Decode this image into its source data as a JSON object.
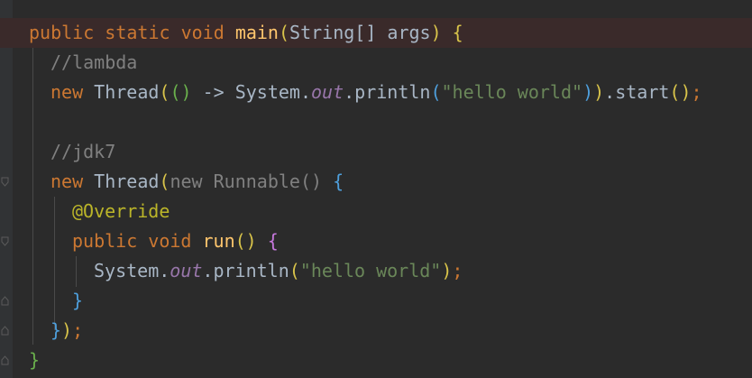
{
  "editor": {
    "lines": [
      {
        "tokens": [
          {
            "text": "public",
            "cls": "kw"
          },
          {
            "text": " ",
            "cls": "id"
          },
          {
            "text": "static",
            "cls": "kw"
          },
          {
            "text": " ",
            "cls": "id"
          },
          {
            "text": "void",
            "cls": "kw"
          },
          {
            "text": " ",
            "cls": "id"
          },
          {
            "text": "main",
            "cls": "fn"
          },
          {
            "text": "(",
            "cls": "b1"
          },
          {
            "text": "String[] args",
            "cls": "id"
          },
          {
            "text": ")",
            "cls": "b1"
          },
          {
            "text": " ",
            "cls": "id"
          },
          {
            "text": "{",
            "cls": "b1"
          }
        ]
      },
      {
        "tokens": [
          {
            "text": "//lambda",
            "cls": "cm"
          }
        ]
      },
      {
        "tokens": [
          {
            "text": "new",
            "cls": "kw"
          },
          {
            "text": " Thread",
            "cls": "id"
          },
          {
            "text": "(",
            "cls": "b1"
          },
          {
            "text": "()",
            "cls": "b4"
          },
          {
            "text": " -> System.",
            "cls": "id"
          },
          {
            "text": "out",
            "cls": "fld"
          },
          {
            "text": ".println",
            "cls": "id"
          },
          {
            "text": "(",
            "cls": "b3"
          },
          {
            "text": "\"hello world\"",
            "cls": "st"
          },
          {
            "text": ")",
            "cls": "b3"
          },
          {
            "text": ")",
            "cls": "b1"
          },
          {
            "text": ".start",
            "cls": "id"
          },
          {
            "text": "()",
            "cls": "b1"
          },
          {
            "text": ";",
            "cls": "kw"
          }
        ]
      },
      {
        "tokens": []
      },
      {
        "tokens": [
          {
            "text": "//jdk7",
            "cls": "cm"
          }
        ]
      },
      {
        "tokens": [
          {
            "text": "new",
            "cls": "kw"
          },
          {
            "text": " Thread",
            "cls": "id"
          },
          {
            "text": "(",
            "cls": "b1"
          },
          {
            "text": "new Runnable",
            "cls": "dim"
          },
          {
            "text": "()",
            "cls": "dim"
          },
          {
            "text": " ",
            "cls": "id"
          },
          {
            "text": "{",
            "cls": "b3"
          }
        ]
      },
      {
        "tokens": [
          {
            "text": "@Override",
            "cls": "an"
          }
        ]
      },
      {
        "tokens": [
          {
            "text": "public",
            "cls": "kw"
          },
          {
            "text": " ",
            "cls": "id"
          },
          {
            "text": "void",
            "cls": "kw"
          },
          {
            "text": " ",
            "cls": "id"
          },
          {
            "text": "run",
            "cls": "fn"
          },
          {
            "text": "()",
            "cls": "b1"
          },
          {
            "text": " ",
            "cls": "id"
          },
          {
            "text": "{",
            "cls": "b2"
          }
        ]
      },
      {
        "tokens": [
          {
            "text": "System.",
            "cls": "id"
          },
          {
            "text": "out",
            "cls": "fld"
          },
          {
            "text": ".println",
            "cls": "id"
          },
          {
            "text": "(",
            "cls": "b1"
          },
          {
            "text": "\"hello world\"",
            "cls": "st"
          },
          {
            "text": ")",
            "cls": "b1"
          },
          {
            "text": ";",
            "cls": "kw"
          }
        ]
      },
      {
        "tokens": [
          {
            "text": "}",
            "cls": "b3"
          }
        ]
      },
      {
        "tokens": [
          {
            "text": "}",
            "cls": "b3"
          },
          {
            "text": ")",
            "cls": "b1"
          },
          {
            "text": ";",
            "cls": "kw"
          }
        ]
      },
      {
        "tokens": [
          {
            "text": "}",
            "cls": "b4"
          }
        ]
      }
    ],
    "colors": {
      "background": "#2b2b2b",
      "gutter": "#313335",
      "current_line": "#3a2a2a",
      "keyword": "#cc7832",
      "method": "#ffc66d",
      "comment": "#808080",
      "string": "#6a8759",
      "static_field": "#9876aa",
      "annotation": "#bbb529",
      "identifier": "#a9b7c6"
    },
    "icons": {
      "fold_marker": "fold-marker-icon"
    }
  }
}
